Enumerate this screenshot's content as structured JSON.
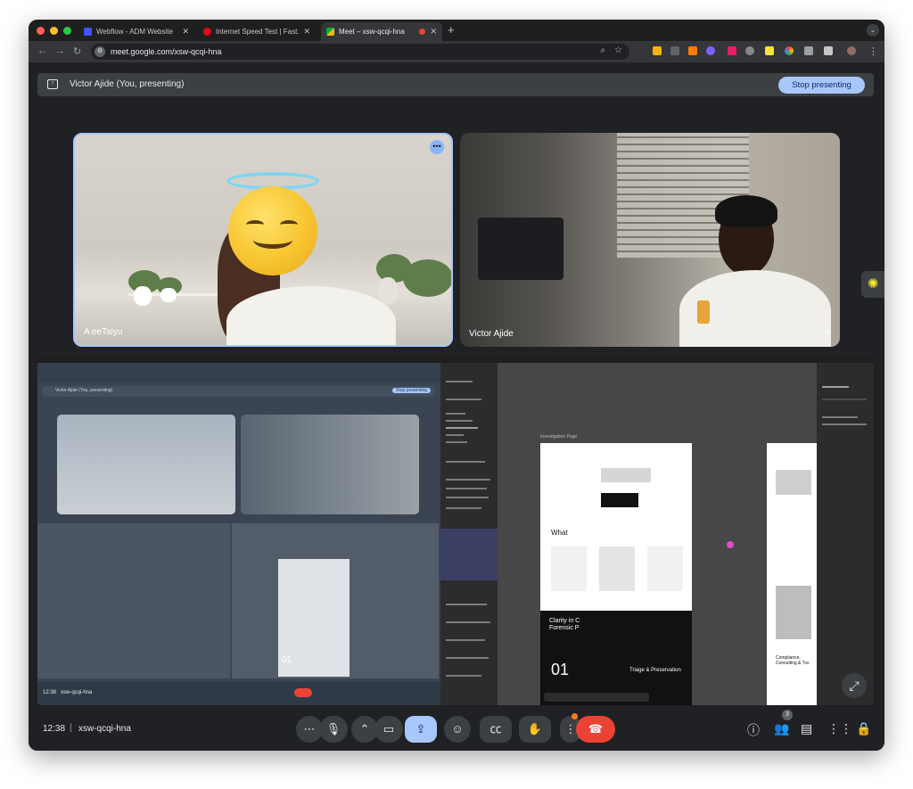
{
  "tabs": [
    {
      "title": "Webflow - ADM Website",
      "favicon": "webflow-icon",
      "color": "#4353ff"
    },
    {
      "title": "Internet Speed Test | Fast.com",
      "favicon": "fast-icon",
      "color": "#e50914"
    },
    {
      "title": "Meet – xsw-qcqi-hna",
      "favicon": "meet-icon",
      "color": "#00ac47"
    }
  ],
  "address": {
    "url": "meet.google.com/xsw-qcqi-hna"
  },
  "presenting": {
    "label": "Victor Ajide (You, presenting)",
    "stop_label": "Stop presenting"
  },
  "participants": [
    {
      "name": "A               eeTaiyu"
    },
    {
      "name": "Victor Ajide"
    }
  ],
  "shared_screen": {
    "figma": {
      "frame_label": "Investigation Page",
      "heading_a": "Clarity in C",
      "heading_b": "Forensic P",
      "what": "What",
      "number": "01",
      "card_title": "Triage & Preservation",
      "side_heading": "Compliance, Consulting & Tra"
    },
    "inner_meet": {
      "presenting_label": "Victor Ajide (You, presenting)",
      "stop_label": "Stop presenting",
      "clock": "12:38",
      "code": "xsw-qcqi-hna"
    }
  },
  "bottom": {
    "time": "12:38",
    "separator": "|",
    "code": "xsw-qcqi-hna",
    "people_count": "3"
  },
  "colors": {
    "accent": "#a8c7fa",
    "hangup": "#ea4335",
    "background": "#202124"
  }
}
